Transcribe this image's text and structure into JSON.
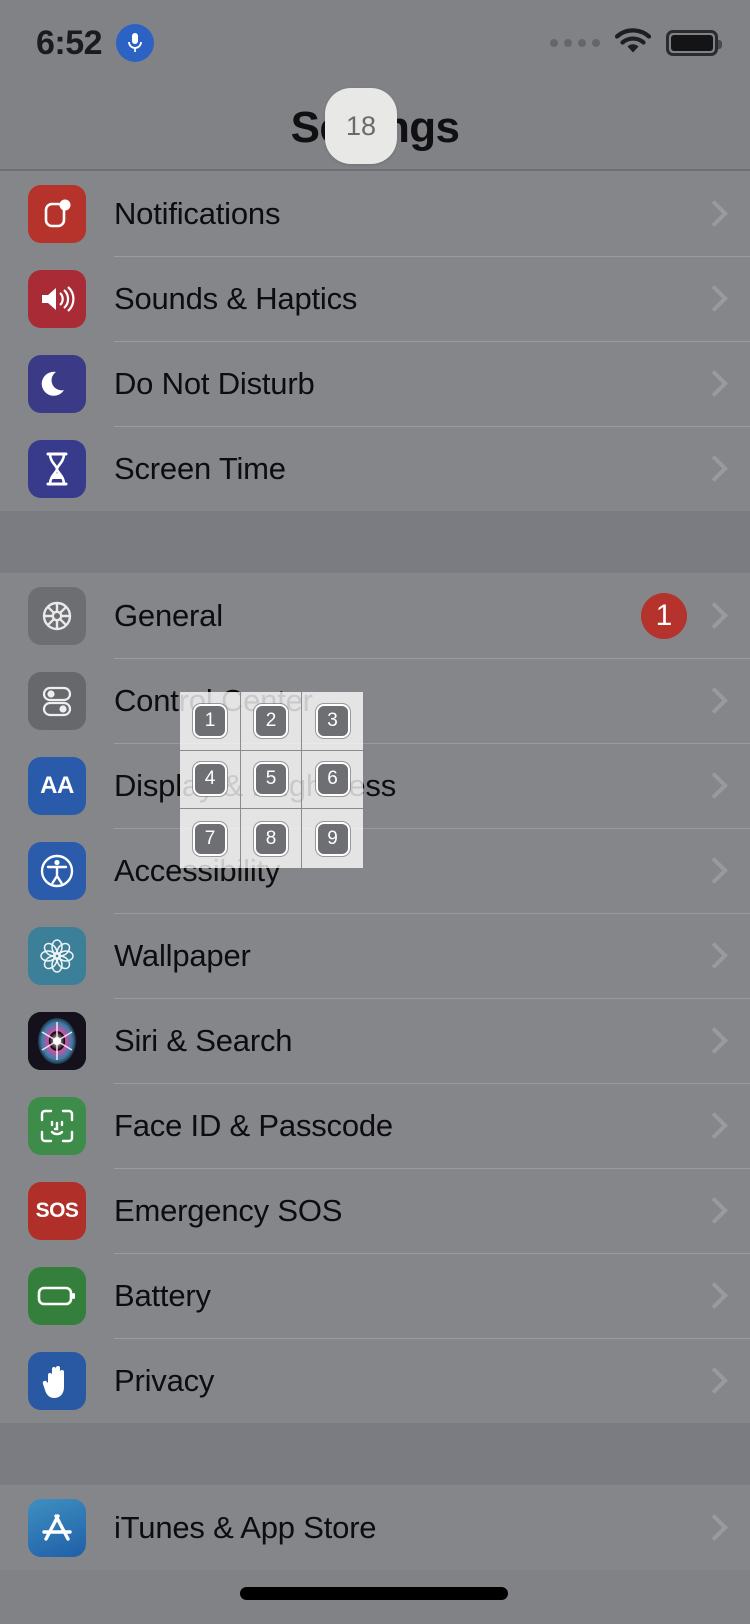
{
  "status_bar": {
    "time": "6:52",
    "mic_icon": "microphone-icon",
    "signal_dots": 4,
    "wifi_icon": "wifi-icon",
    "battery_icon": "battery-full-icon"
  },
  "nav": {
    "title": "Settings"
  },
  "float_badge": {
    "value": "18"
  },
  "groups": [
    {
      "rows": [
        {
          "label": "Notifications",
          "icon": "notifications-icon",
          "icon_class": "ic-notifications",
          "badge": null,
          "chevron": true
        },
        {
          "label": "Sounds & Haptics",
          "icon": "sounds-icon",
          "icon_class": "ic-sounds",
          "badge": null,
          "chevron": true
        },
        {
          "label": "Do Not Disturb",
          "icon": "moon-icon",
          "icon_class": "ic-dnd",
          "badge": null,
          "chevron": true
        },
        {
          "label": "Screen Time",
          "icon": "hourglass-icon",
          "icon_class": "ic-screentime",
          "badge": null,
          "chevron": true
        }
      ]
    },
    {
      "rows": [
        {
          "label": "General",
          "icon": "gear-icon",
          "icon_class": "ic-general",
          "badge": "1",
          "chevron": true
        },
        {
          "label": "Control Center",
          "icon": "toggles-icon",
          "icon_class": "ic-control",
          "badge": null,
          "chevron": true
        },
        {
          "label": "Display & Brightness",
          "icon": "aa-icon",
          "icon_class": "ic-display",
          "badge": null,
          "chevron": true
        },
        {
          "label": "Accessibility",
          "icon": "accessibility-icon",
          "icon_class": "ic-accessibility",
          "badge": null,
          "chevron": true
        },
        {
          "label": "Wallpaper",
          "icon": "flower-icon",
          "icon_class": "ic-wallpaper",
          "badge": null,
          "chevron": true
        },
        {
          "label": "Siri & Search",
          "icon": "siri-icon",
          "icon_class": "ic-siri",
          "badge": null,
          "chevron": true
        },
        {
          "label": "Face ID & Passcode",
          "icon": "faceid-icon",
          "icon_class": "ic-faceid",
          "badge": null,
          "chevron": true
        },
        {
          "label": "Emergency SOS",
          "icon": "sos-icon",
          "icon_class": "ic-sos",
          "badge": null,
          "chevron": true
        },
        {
          "label": "Battery",
          "icon": "battery-icon",
          "icon_class": "ic-battery",
          "badge": null,
          "chevron": true
        },
        {
          "label": "Privacy",
          "icon": "hand-icon",
          "icon_class": "ic-privacy",
          "badge": null,
          "chevron": true
        }
      ]
    },
    {
      "rows": [
        {
          "label": "iTunes & App Store",
          "icon": "app-store-icon",
          "icon_class": "ic-appstore",
          "badge": null,
          "chevron": true
        }
      ]
    }
  ],
  "grid_overlay": {
    "cells": [
      "1",
      "2",
      "3",
      "4",
      "5",
      "6",
      "7",
      "8",
      "9"
    ]
  },
  "colors": {
    "screen_bg": "#818285",
    "row_bg": "#85868a",
    "gap_bg": "#7b7c81",
    "badge_red": "#b4332c",
    "mic_blue": "#2b62c4"
  }
}
